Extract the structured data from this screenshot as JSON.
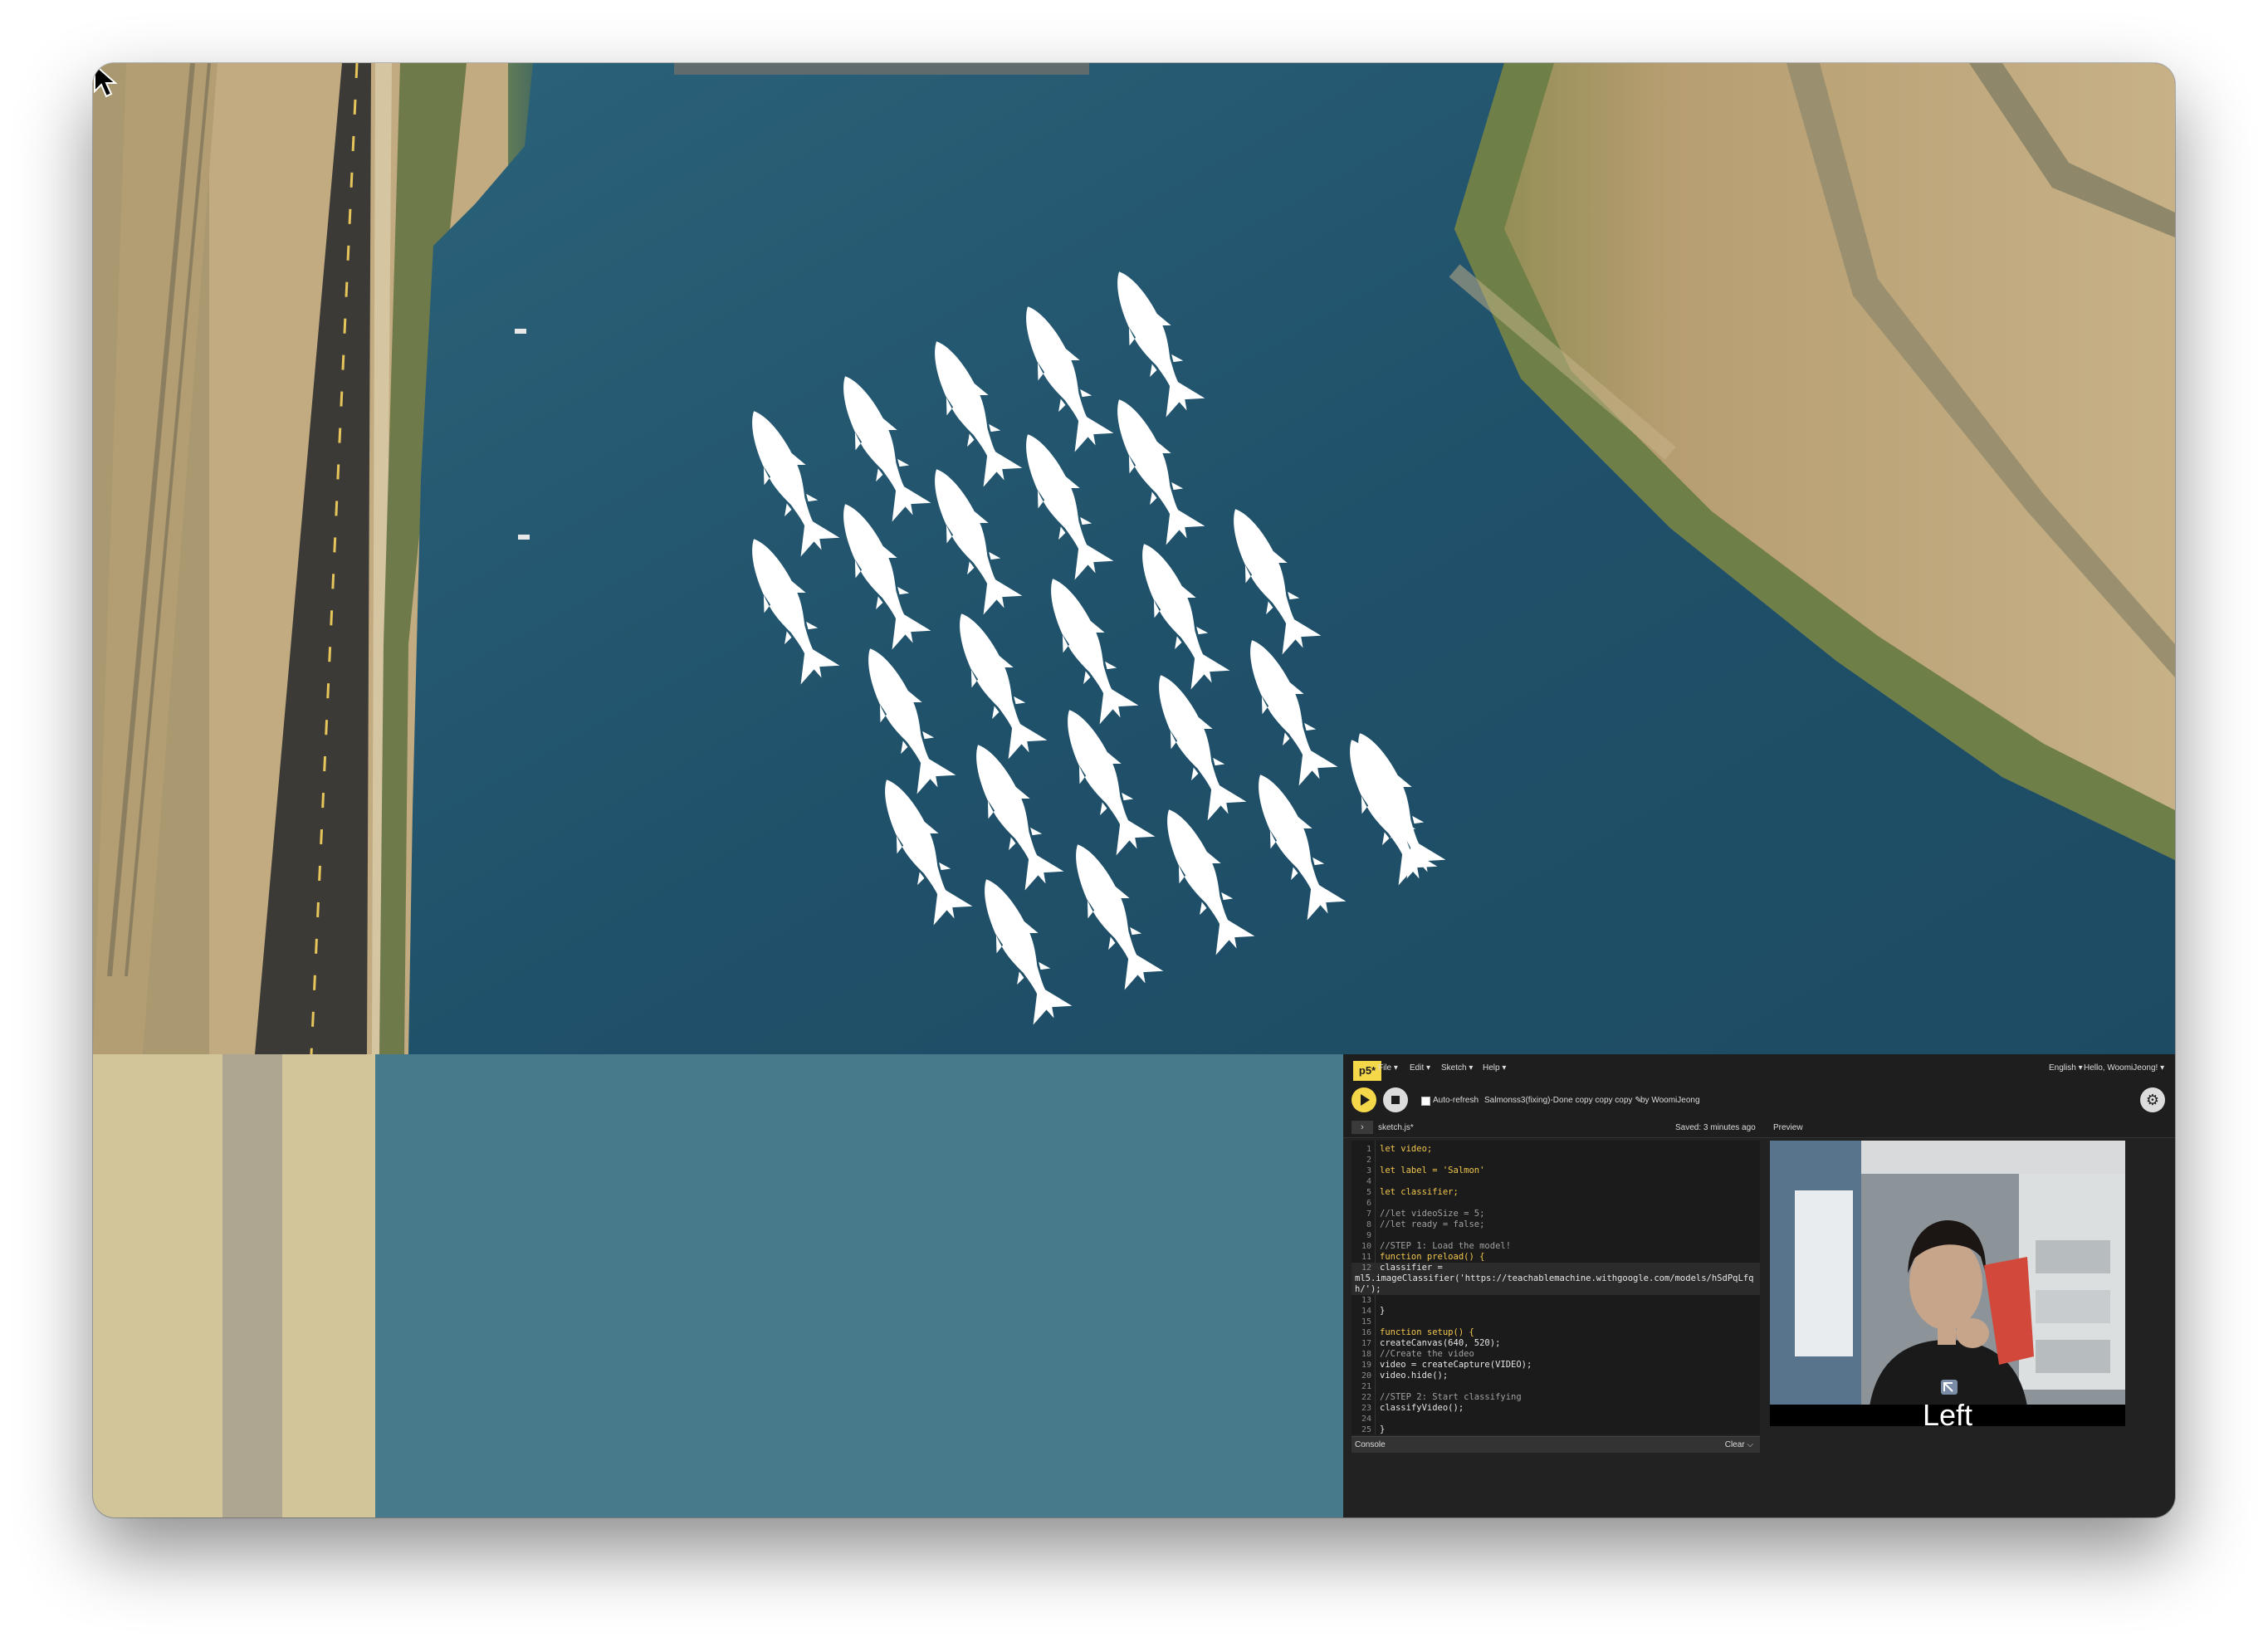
{
  "canvas": {
    "background_colors": {
      "river": "#23536a",
      "land": "#c4ad83",
      "lower_sand": "#d3c59a",
      "lower_water": "#477a8b"
    },
    "fish_icon": "salmon-silhouette-icon",
    "fish_count": 26
  },
  "editor": {
    "logo": "p5*",
    "menu": [
      "File ▾",
      "Edit ▾",
      "Sketch ▾",
      "Help ▾"
    ],
    "language": "English ▾",
    "user": "Hello, WoomiJeong! ▾",
    "auto_refresh_label": "Auto-refresh",
    "sketch_name": "Salmonss3(fixing)-Done copy copy copy ✎",
    "author": "by WoomiJeong",
    "file_tab": "sketch.js*",
    "saved_status": "Saved: 3 minutes ago",
    "preview_label": "Preview",
    "console_label": "Console",
    "clear_label": "Clear ⌵",
    "code_lines": [
      {
        "n": "1",
        "text": "let video;"
      },
      {
        "n": "2",
        "text": ""
      },
      {
        "n": "3",
        "text": "let label = 'Salmon'"
      },
      {
        "n": "4",
        "text": ""
      },
      {
        "n": "5",
        "text": "let classifier;"
      },
      {
        "n": "6",
        "text": ""
      },
      {
        "n": "7",
        "text": "//let videoSize = 5;"
      },
      {
        "n": "8",
        "text": "//let ready = false;"
      },
      {
        "n": "9",
        "text": ""
      },
      {
        "n": "10",
        "text": "//STEP 1: Load the model!"
      },
      {
        "n": "11",
        "text": "function preload() {"
      },
      {
        "n": "12",
        "text": "  classifier ="
      },
      {
        "n": "",
        "text": "ml5.imageClassifier('https://teachablemachine.withgoogle.com/models/hSdPqLfq"
      },
      {
        "n": "",
        "text": "h/');"
      },
      {
        "n": "13",
        "text": ""
      },
      {
        "n": "14",
        "text": "}"
      },
      {
        "n": "15",
        "text": ""
      },
      {
        "n": "16",
        "text": "function setup() {"
      },
      {
        "n": "17",
        "text": "  createCanvas(640, 520);"
      },
      {
        "n": "18",
        "text": "  //Create the video"
      },
      {
        "n": "19",
        "text": "  video = createCapture(VIDEO);"
      },
      {
        "n": "20",
        "text": "  video.hide();"
      },
      {
        "n": "21",
        "text": ""
      },
      {
        "n": "22",
        "text": "  //STEP 2: Start classifying"
      },
      {
        "n": "23",
        "text": "  classifyVideo();"
      },
      {
        "n": "24",
        "text": ""
      },
      {
        "n": "25",
        "text": "}"
      }
    ],
    "webcam_label": "Left"
  }
}
